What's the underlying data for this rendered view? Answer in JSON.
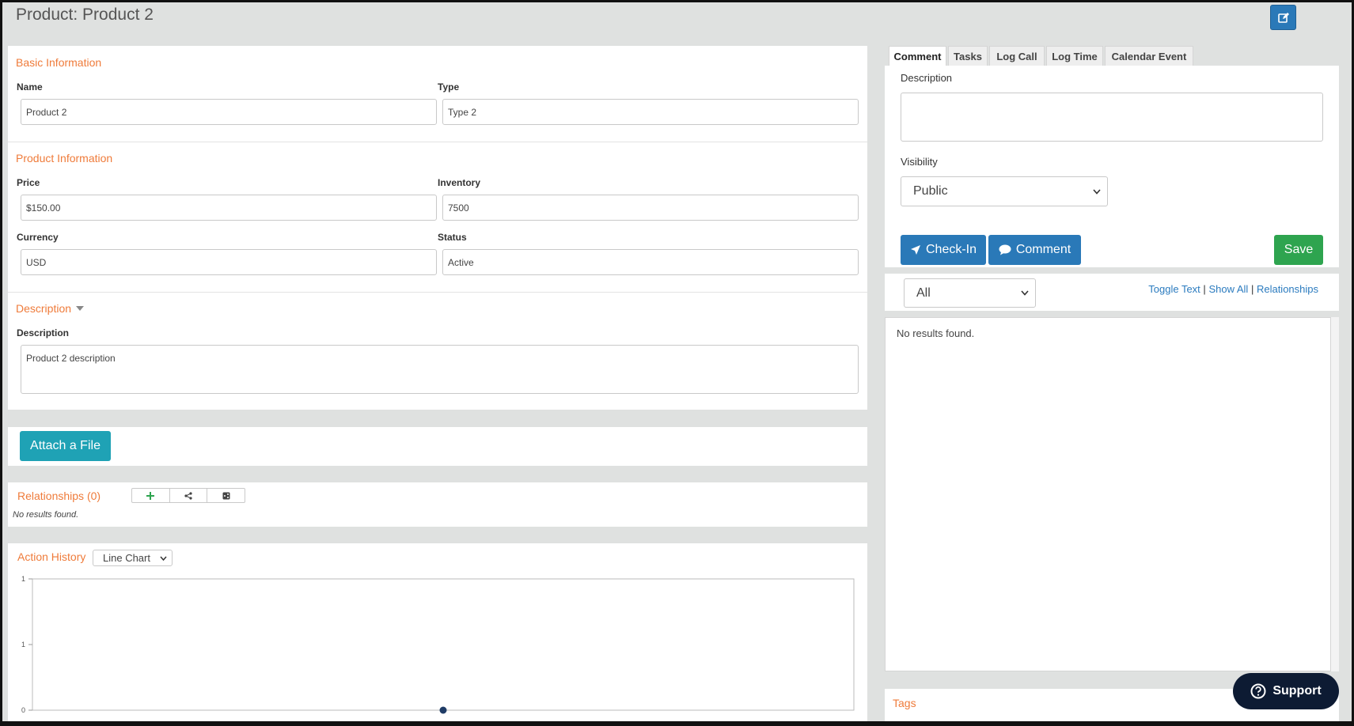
{
  "header": {
    "title": "Product: Product 2"
  },
  "basic_info": {
    "title": "Basic Information",
    "name_label": "Name",
    "name_value": "Product 2",
    "type_label": "Type",
    "type_value": "Type 2"
  },
  "product_info": {
    "title": "Product Information",
    "price_label": "Price",
    "price_value": "$150.00",
    "inventory_label": "Inventory",
    "inventory_value": "7500",
    "currency_label": "Currency",
    "currency_value": "USD",
    "status_label": "Status",
    "status_value": "Active"
  },
  "description_section": {
    "title": "Description",
    "label": "Description",
    "value": "Product 2 description"
  },
  "attach": {
    "label": "Attach a File"
  },
  "relationships": {
    "title": "Relationships (0)",
    "empty": "No results found."
  },
  "action_history": {
    "title": "Action History",
    "chart_type_selected": "Line Chart"
  },
  "chart_data": {
    "type": "line",
    "title": "",
    "xlabel": "",
    "ylabel": "",
    "y_tick_labels": [
      "1",
      "1",
      "0"
    ],
    "points": [
      {
        "x": 0.5,
        "y": 0
      }
    ],
    "ylim": [
      0,
      1
    ],
    "grid": false
  },
  "compose": {
    "tabs": [
      {
        "label": "Comment",
        "active": true
      },
      {
        "label": "Tasks",
        "active": false
      },
      {
        "label": "Log Call",
        "active": false
      },
      {
        "label": "Log Time",
        "active": false
      },
      {
        "label": "Calendar Event",
        "active": false
      }
    ],
    "description_label": "Description",
    "visibility_label": "Visibility",
    "visibility_value": "Public",
    "checkin_label": "Check-In",
    "comment_label": "Comment",
    "save_label": "Save"
  },
  "history_filter": {
    "filter_value": "All",
    "toggle_text": "Toggle Text",
    "show_all": "Show All",
    "relationships": "Relationships",
    "sep": "|",
    "empty": "No results found."
  },
  "tags": {
    "title": "Tags"
  },
  "support": {
    "label": "Support"
  },
  "colors": {
    "accent_orange": "#ef7b3a",
    "primary_blue": "#2a79b8",
    "teal": "#1fa2b5",
    "green": "#2ea44f",
    "navy": "#0d1b33"
  }
}
